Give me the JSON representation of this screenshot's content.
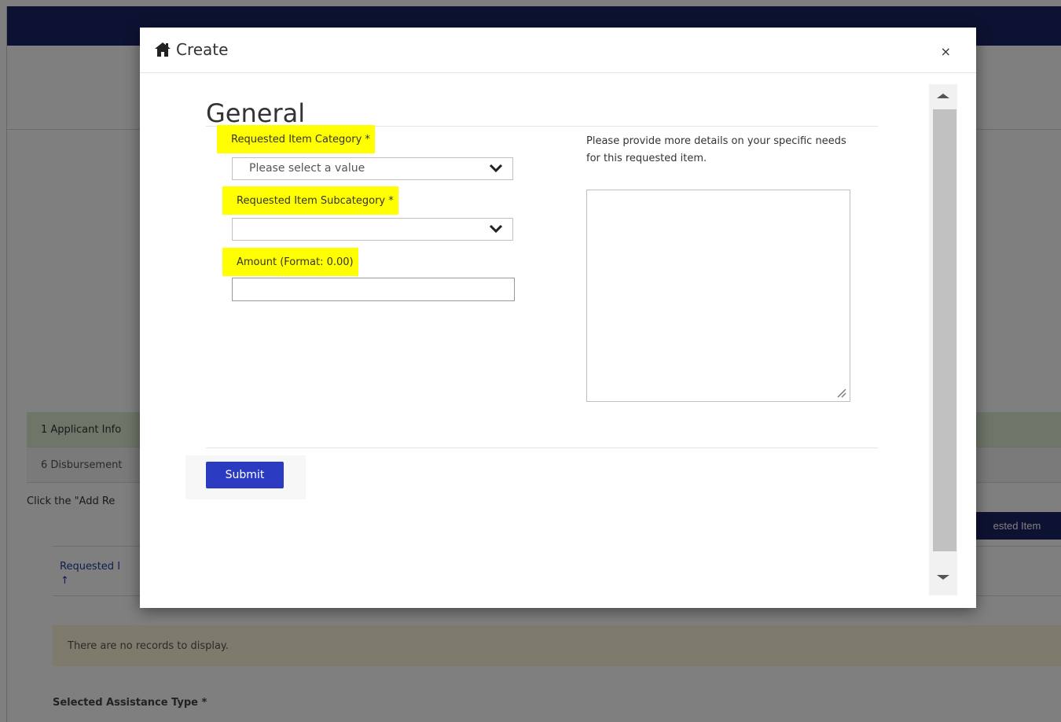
{
  "background": {
    "steps": [
      "1 Applicant Info",
      "6 Disbursement"
    ],
    "instruction": "Click the \"Add Re",
    "add_button_label": "ested Item",
    "grid_column": "Requested I",
    "sort_icon": "arrow-up",
    "sort_glyph": "↑",
    "empty_message": "There are no records to display.",
    "assistance_type_label": "Selected Assistance Type *"
  },
  "modal": {
    "title": "Create",
    "title_icon": "home-icon",
    "close_label": "×",
    "section_title": "General",
    "fields": {
      "category": {
        "label": "Requested Item Category *",
        "value": "Please select a value"
      },
      "subcategory": {
        "label": "Requested Item Subcategory *",
        "value": ""
      },
      "amount": {
        "label": "Amount (Format: 0.00)",
        "value": ""
      }
    },
    "details": {
      "label": "Please provide more details on your specific needs for this requested item.",
      "value": ""
    },
    "submit_label": "Submit"
  },
  "colors": {
    "top_bar": "#1a2464",
    "highlight": "#ffff00",
    "submit": "#2b3bc1",
    "link": "#1f3d9c"
  }
}
